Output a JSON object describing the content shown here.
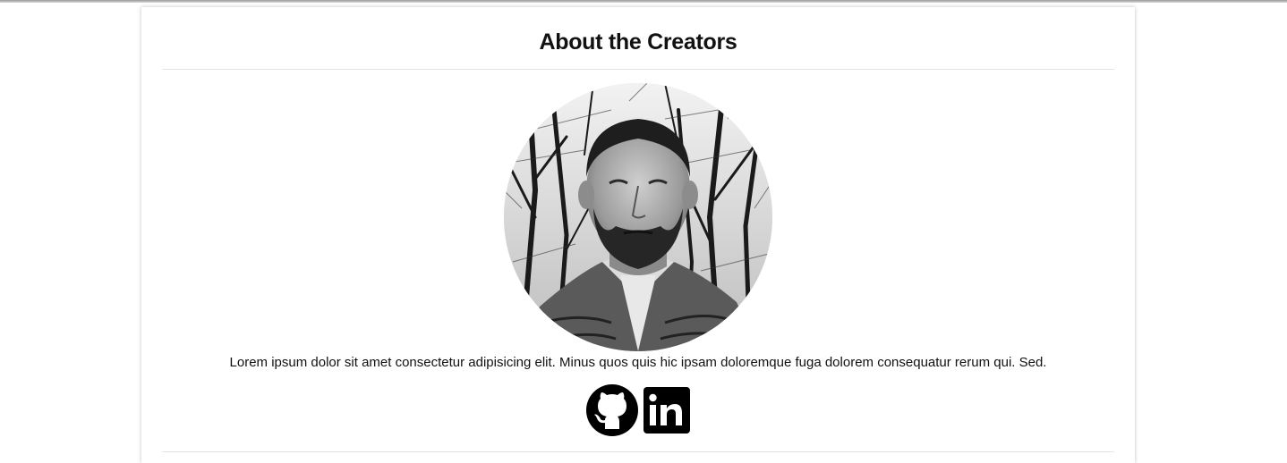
{
  "section": {
    "title": "About the Creators",
    "bio": "Lorem ipsum dolor sit amet consectetur adipisicing elit. Minus quos quis hic ipsam doloremque fuga dolorem consequatur rerum qui. Sed."
  },
  "portrait": {
    "alt": "creator portrait"
  },
  "socials": [
    {
      "icon": "github-icon"
    },
    {
      "icon": "linkedin-icon"
    }
  ],
  "colors": {
    "text": "#111111",
    "divider": "#e3e3e3",
    "background": "#ffffff"
  }
}
